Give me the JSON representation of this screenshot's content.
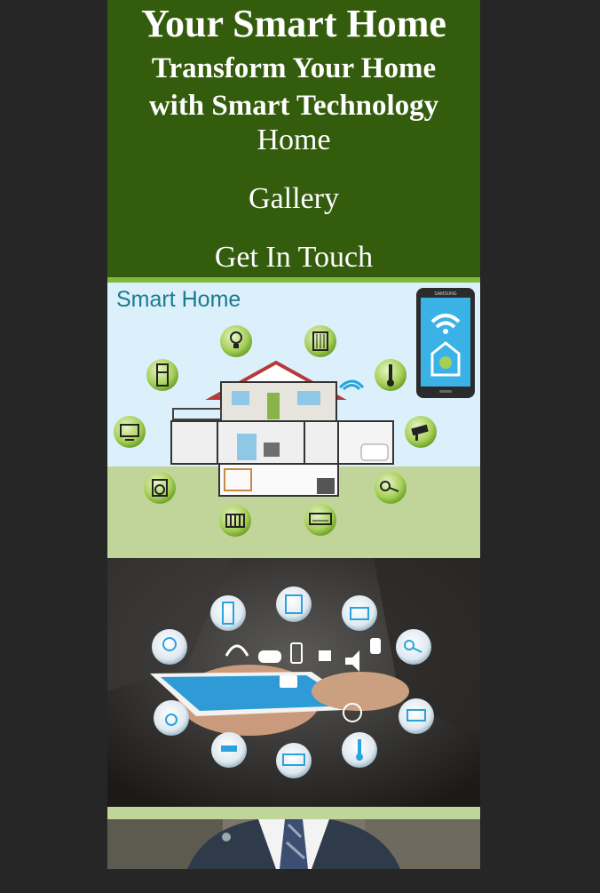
{
  "header": {
    "title": "Your Smart Home",
    "tagline_line1": "Transform Your Home",
    "tagline_line2": "with Smart Technology"
  },
  "nav": {
    "items": [
      {
        "label": "Home"
      },
      {
        "label": "Gallery"
      },
      {
        "label": "Get In Touch"
      }
    ]
  },
  "hero1": {
    "label": "Smart Home",
    "phone_brand": "SAMSUNG"
  },
  "colors": {
    "header_bg": "#335c0c",
    "accent_green": "#7dbb3e",
    "page_bg": "#262626",
    "band": "#c0d59a"
  }
}
